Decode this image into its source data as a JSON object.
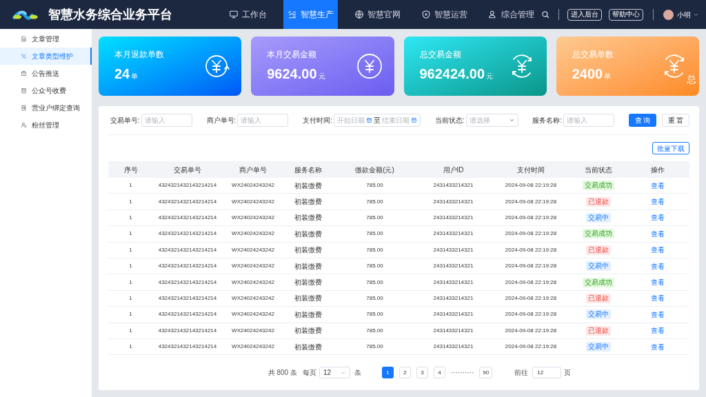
{
  "app": {
    "title": "智慧水务综合业务平台"
  },
  "nav": [
    {
      "label": "工作台",
      "selected": false
    },
    {
      "label": "智慧生产",
      "selected": true
    },
    {
      "label": "智慧官网",
      "selected": false
    },
    {
      "label": "智慧运营",
      "selected": false
    },
    {
      "label": "综合管理",
      "selected": false
    }
  ],
  "header_buttons": [
    "进入后台",
    "帮助中心"
  ],
  "user": {
    "name": "小明"
  },
  "sidebar": {
    "items": [
      {
        "label": "文章管理",
        "selected": false
      },
      {
        "label": "文章类型维护",
        "selected": true
      },
      {
        "label": "公告推送",
        "selected": false
      },
      {
        "label": "公众号收费",
        "selected": false
      },
      {
        "label": "营业户绑定查询",
        "selected": false
      },
      {
        "label": "粉丝管理",
        "selected": false
      }
    ]
  },
  "stats": [
    {
      "title": "本月退款单数",
      "value": "24",
      "unit": "单",
      "kind": "blue"
    },
    {
      "title": "本月交易金额",
      "value": "9624.00",
      "unit": "元",
      "kind": "purple"
    },
    {
      "title": "总交易金额",
      "value": "962424.00",
      "unit": "元",
      "kind": "teal"
    },
    {
      "title": "总交易单数",
      "value": "2400",
      "unit": "单",
      "kind": "orange",
      "badge": "总"
    }
  ],
  "filters": [
    {
      "label": "交易单号:",
      "kind": "input",
      "placeholder": "请输入"
    },
    {
      "label": "商户单号:",
      "kind": "input",
      "placeholder": "请输入"
    },
    {
      "label": "支付时间:",
      "kind": "daterange",
      "start_placeholder": "开始日期",
      "separator": "至",
      "end_placeholder": "结束日期"
    },
    {
      "label": "当前状态:",
      "kind": "select",
      "placeholder": "请选择"
    },
    {
      "label": "服务名称:",
      "kind": "input",
      "placeholder": "请输入"
    }
  ],
  "filter_buttons": [
    {
      "label": "查 询",
      "kind": "primary"
    },
    {
      "label": "重 置",
      "kind": "default"
    }
  ],
  "batch_button": "批量下载",
  "table": {
    "columns": [
      "序号",
      "交易单号",
      "商户单号",
      "服务名称",
      "缴款金额(元)",
      "用户ID",
      "支付时间",
      "当前状态",
      "操作"
    ],
    "rows": [
      {
        "cells": [
          "1",
          "4324321432143214214",
          "WX24024243242",
          "初装缴费",
          "785.00",
          "2431433214321",
          "2024-09-08 22:19:28"
        ],
        "status": {
          "text": "交易成功",
          "kind": "success"
        },
        "action": "查看"
      },
      {
        "cells": [
          "1",
          "4324321432143214214",
          "WX24024243242",
          "初装缴费",
          "785.00",
          "2431433214321",
          "2024-09-08 22:19:28"
        ],
        "status": {
          "text": "已退款",
          "kind": "refunded"
        },
        "action": "查看"
      },
      {
        "cells": [
          "1",
          "4324321432143214214",
          "WX24024243242",
          "初装缴费",
          "785.00",
          "2431433214321",
          "2024-09-08 22:19:28"
        ],
        "status": {
          "text": "交易中",
          "kind": "pending"
        },
        "action": "查看"
      },
      {
        "cells": [
          "1",
          "4324321432143214214",
          "WX24024243242",
          "初装缴费",
          "785.00",
          "2431433214321",
          "2024-09-08 22:19:28"
        ],
        "status": {
          "text": "交易成功",
          "kind": "success"
        },
        "action": "查看"
      },
      {
        "cells": [
          "1",
          "4324321432143214214",
          "WX24024243242",
          "初装缴费",
          "785.00",
          "2431433214321",
          "2024-09-08 22:19:28"
        ],
        "status": {
          "text": "已退款",
          "kind": "refunded"
        },
        "action": "查看"
      },
      {
        "cells": [
          "1",
          "4324321432143214214",
          "WX24024243242",
          "初装缴费",
          "785.00",
          "2431433214321",
          "2024-09-08 22:19:28"
        ],
        "status": {
          "text": "交易中",
          "kind": "pending"
        },
        "action": "查看"
      },
      {
        "cells": [
          "1",
          "4324321432143214214",
          "WX24024243242",
          "初装缴费",
          "785.00",
          "2431433214321",
          "2024-09-08 22:19:28"
        ],
        "status": {
          "text": "交易成功",
          "kind": "success"
        },
        "action": "查看"
      },
      {
        "cells": [
          "1",
          "4324321432143214214",
          "WX24024243242",
          "初装缴费",
          "785.00",
          "2431433214321",
          "2024-09-08 22:19:28"
        ],
        "status": {
          "text": "已退款",
          "kind": "refunded"
        },
        "action": "查看"
      },
      {
        "cells": [
          "1",
          "4324321432143214214",
          "WX24024243242",
          "初装缴费",
          "785.00",
          "2431433214321",
          "2024-09-08 22:19:28"
        ],
        "status": {
          "text": "交易中",
          "kind": "pending"
        },
        "action": "查看"
      },
      {
        "cells": [
          "1",
          "4324321432143214214",
          "WX24024243242",
          "初装缴费",
          "785.00",
          "2431433214321",
          "2024-09-08 22:19:28"
        ],
        "status": {
          "text": "已退款",
          "kind": "refunded"
        },
        "action": "查看"
      },
      {
        "cells": [
          "1",
          "4324321432143214214",
          "WX24024243242",
          "初装缴费",
          "785.00",
          "2431433214321",
          "2024-09-08 22:19:28"
        ],
        "status": {
          "text": "交易中",
          "kind": "pending"
        },
        "action": "查看"
      }
    ]
  },
  "pagination": {
    "total": "共 800 条",
    "per_page_label": "每页",
    "per_page": "12",
    "per_page_unit": "条",
    "pages": [
      {
        "label": "1",
        "selected": true
      },
      {
        "label": "2",
        "selected": false
      },
      {
        "label": "3",
        "selected": false
      },
      {
        "label": "4",
        "selected": false
      }
    ],
    "ellipsis": "··········",
    "last_page": "90",
    "goto_label": "前往",
    "goto_value": "12",
    "goto_unit": "页"
  }
}
